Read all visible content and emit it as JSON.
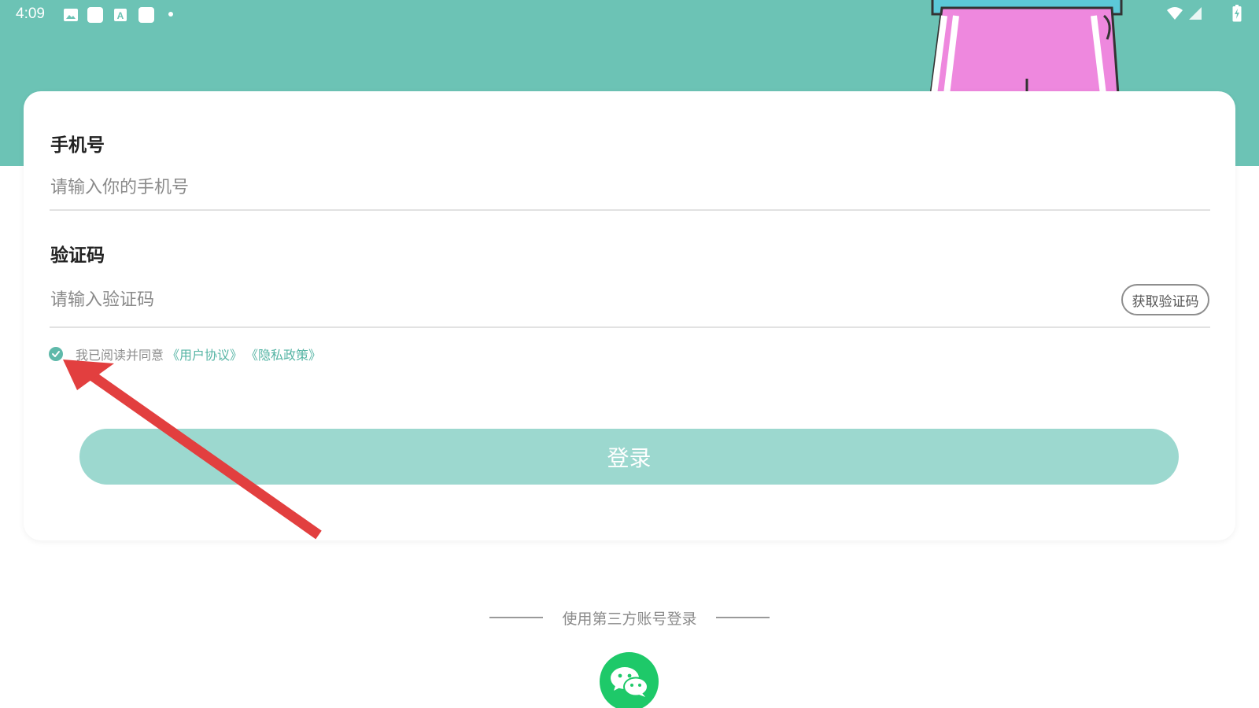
{
  "status_bar": {
    "time": "4:09",
    "icons": [
      "image-icon",
      "app-square-icon",
      "font-a-icon",
      "app-square-icon",
      "dot-icon",
      "wifi-icon",
      "cell-signal-icon",
      "battery-charging-icon"
    ]
  },
  "colors": {
    "header": "#6cc3b5",
    "accent": "#55b4a4",
    "login_button": "#9cd8cf",
    "wechat": "#1ec969",
    "arrow": "#e23f3f"
  },
  "form": {
    "phone_label": "手机号",
    "phone_placeholder": "请输入你的手机号",
    "code_label": "验证码",
    "code_placeholder": "请输入验证码",
    "get_code_button": "获取验证码",
    "agreement_prefix": "我已阅读并同意",
    "user_agreement_link": "《用户协议》",
    "privacy_policy_link": "《隐私政策》",
    "agreement_checked": true,
    "login_button": "登录"
  },
  "third_party": {
    "label": "使用第三方账号登录",
    "wechat_icon": "wechat-icon"
  }
}
